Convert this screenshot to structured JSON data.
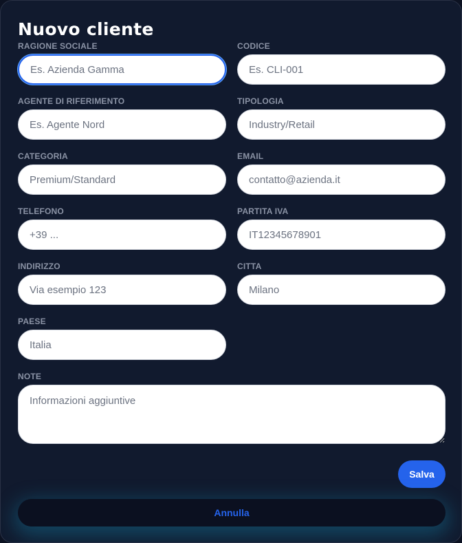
{
  "modal": {
    "title": "Nuovo cliente"
  },
  "fields": {
    "ragione_sociale": {
      "label": "RAGIONE SOCIALE",
      "placeholder": "Es. Azienda Gamma",
      "value": ""
    },
    "codice": {
      "label": "CODICE",
      "placeholder": "Es. CLI-001",
      "value": ""
    },
    "agente": {
      "label": "AGENTE DI RIFERIMENTO",
      "placeholder": "Es. Agente Nord",
      "value": ""
    },
    "tipologia": {
      "label": "TIPOLOGIA",
      "placeholder": "Industry/Retail",
      "value": ""
    },
    "categoria": {
      "label": "CATEGORIA",
      "placeholder": "Premium/Standard",
      "value": ""
    },
    "email": {
      "label": "EMAIL",
      "placeholder": "contatto@azienda.it",
      "value": ""
    },
    "telefono": {
      "label": "TELEFONO",
      "placeholder": "+39 ...",
      "value": ""
    },
    "partita_iva": {
      "label": "PARTITA IVA",
      "placeholder": "IT12345678901",
      "value": ""
    },
    "indirizzo": {
      "label": "INDIRIZZO",
      "placeholder": "Via esempio 123",
      "value": ""
    },
    "citta": {
      "label": "CITTA",
      "placeholder": "Milano",
      "value": ""
    },
    "paese": {
      "label": "PAESE",
      "placeholder": "Italia",
      "value": ""
    },
    "note": {
      "label": "NOTE",
      "placeholder": "Informazioni aggiuntive",
      "value": ""
    }
  },
  "actions": {
    "save_label": "Salva",
    "cancel_label": "Annulla"
  },
  "colors": {
    "accent": "#2563eb",
    "background": "#111a2e",
    "label": "#8b93a5",
    "cancel_glow": "#1496be"
  }
}
